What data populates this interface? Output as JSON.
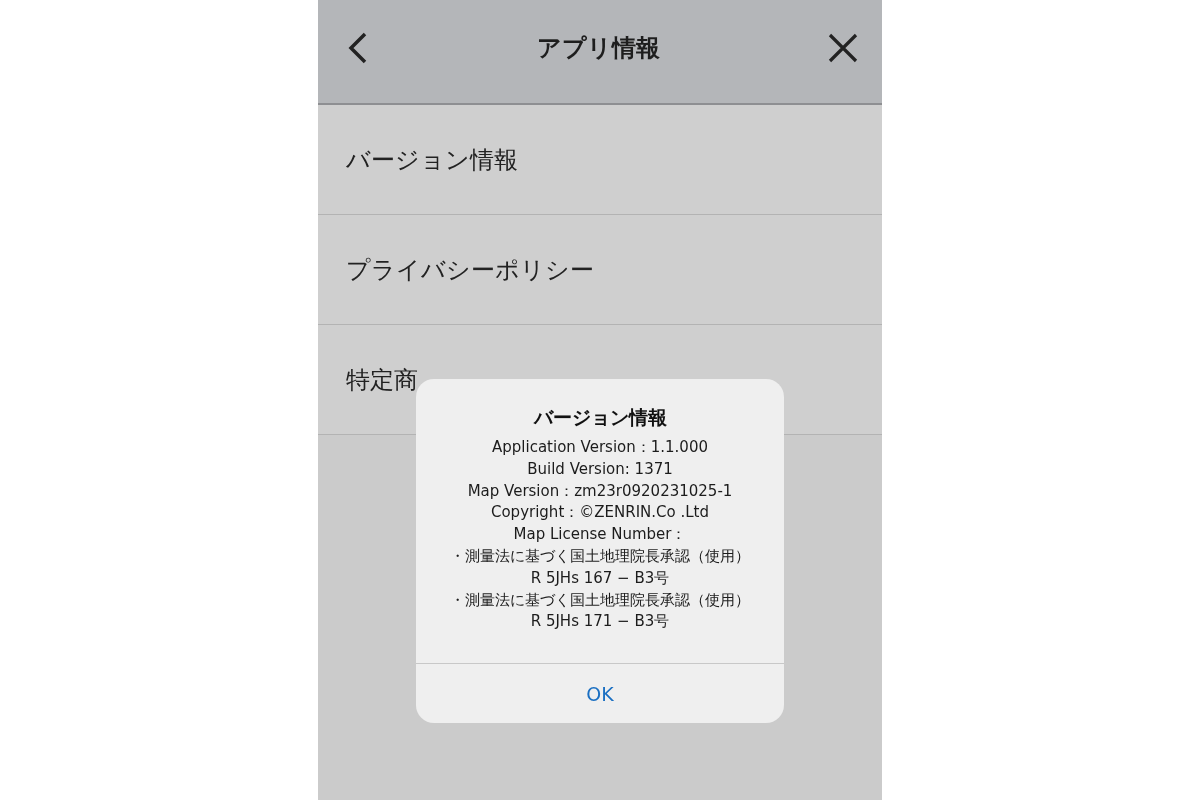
{
  "header": {
    "title": "アプリ情報"
  },
  "menu": [
    {
      "label": "バージョン情報"
    },
    {
      "label": "プライバシーポリシー"
    },
    {
      "label": "特定商"
    }
  ],
  "dialog": {
    "title": "バージョン情報",
    "lines": [
      "Application Version：1.1.000",
      "Build Version: 1371",
      "Map Version：zm23r0920231025-1",
      "Copyright：©ZENRIN.Co .Ltd",
      "Map License Number：",
      "・測量法に基づく国土地理院長承認（使用）",
      "R 5JHs 167 − B3号",
      "・測量法に基づく国土地理院長承認（使用）",
      "R 5JHs 171 − B3号"
    ],
    "button": "OK"
  }
}
